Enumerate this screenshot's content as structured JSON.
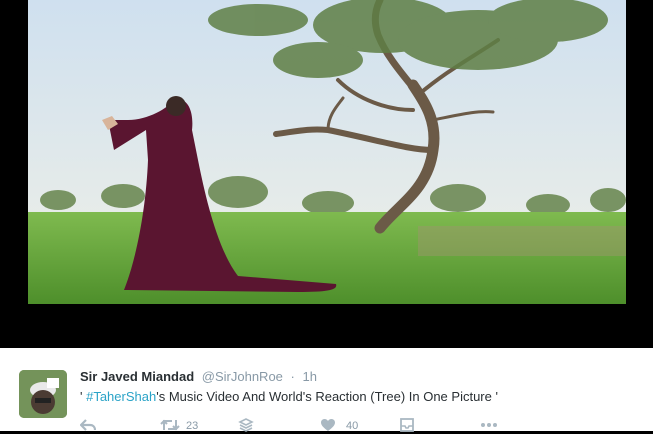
{
  "tweet": {
    "display_name": "Sir Javed Miandad",
    "handle": "@SirJohnRoe",
    "separator": "·",
    "time": "1h",
    "text_prefix": "' ",
    "hashtag": "#TaherShah",
    "text_rest": "'s Music Video And World's Reaction (Tree) In One Picture '",
    "retweet_count": "23",
    "like_count": "40"
  },
  "icons": [
    "reply-icon",
    "retweet-icon",
    "stack-icon",
    "heart-icon",
    "inbox-icon",
    "more-icon"
  ],
  "colors": {
    "background": "#000000",
    "card": "#ffffff",
    "name": "#292f33",
    "muted": "#8899a6",
    "hashtag": "#2aa3c7",
    "icon": "#aab8c2"
  }
}
